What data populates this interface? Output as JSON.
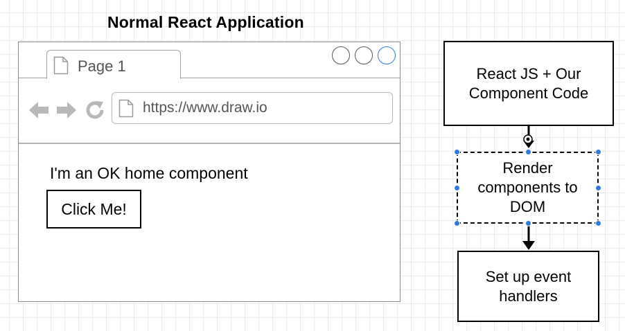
{
  "title": "Normal React Application",
  "browser": {
    "tab_label": "Page 1",
    "url": "https://www.draw.io",
    "content_text": "I'm an OK home component",
    "button_label": "Click Me!"
  },
  "flow": {
    "step1": "React JS + Our Component Code",
    "step2": "Render components to DOM",
    "step3": "Set up event handlers"
  },
  "colors": {
    "selection": "#2f7ad9",
    "icon_gray": "#b8b8b8"
  }
}
